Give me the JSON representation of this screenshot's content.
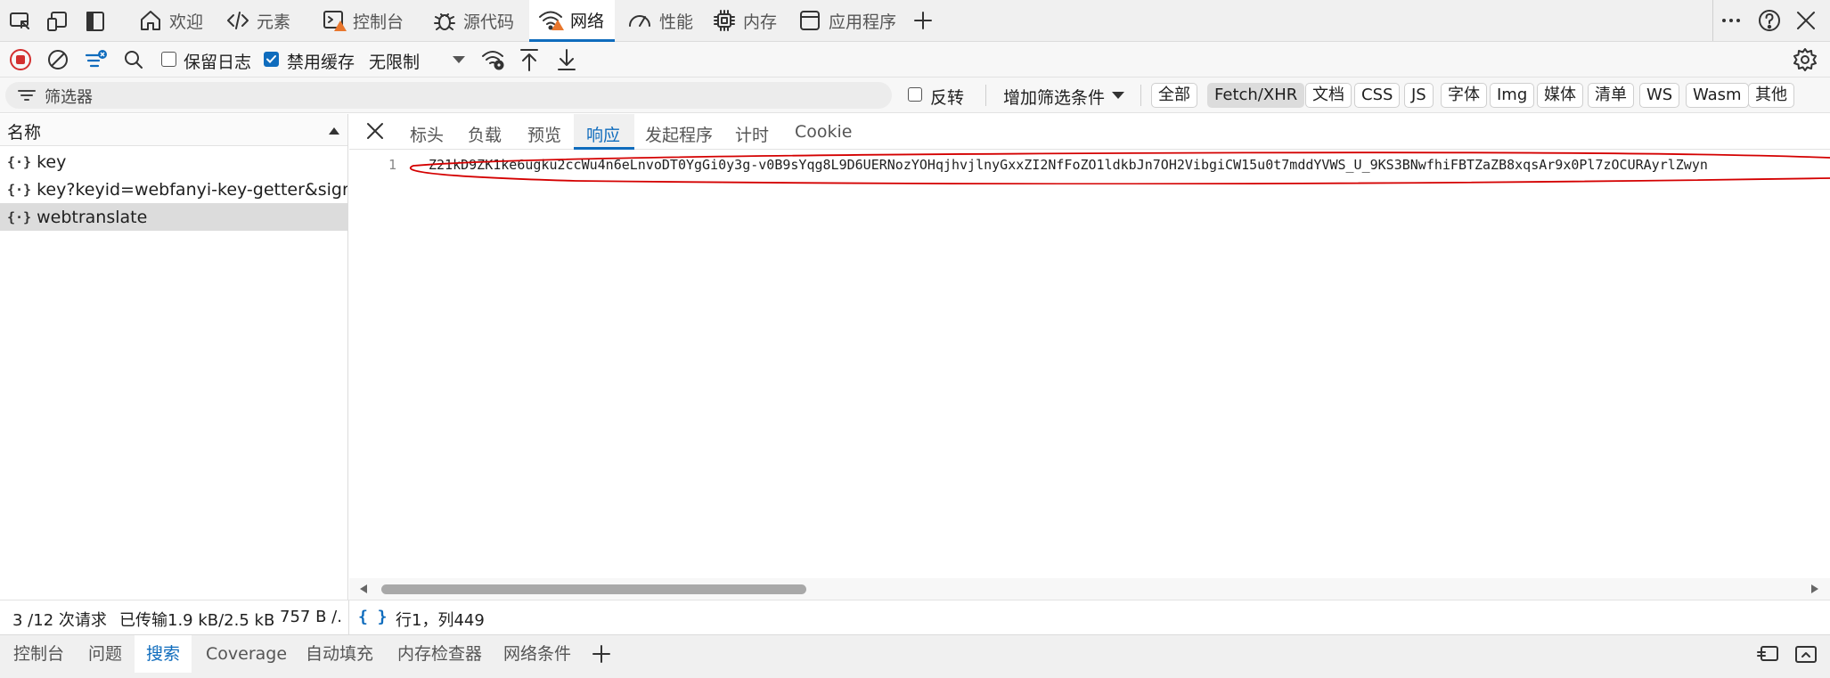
{
  "top_tabs": [
    {
      "label": "欢迎",
      "icon": "home-icon"
    },
    {
      "label": "元素",
      "icon": "code-icon"
    },
    {
      "label": "控制台",
      "icon": "console-icon"
    },
    {
      "label": "源代码",
      "icon": "bug-icon"
    },
    {
      "label": "网络",
      "icon": "wifi-icon"
    },
    {
      "label": "性能",
      "icon": "gauge-icon"
    },
    {
      "label": "内存",
      "icon": "chip-icon"
    },
    {
      "label": "应用程序",
      "icon": "app-icon"
    }
  ],
  "toolbar": {
    "preserve_log_label": "保留日志",
    "preserve_log_checked": false,
    "disable_cache_label": "禁用缓存",
    "disable_cache_checked": true,
    "throttle_value": "无限制"
  },
  "filter": {
    "placeholder": "筛选器",
    "invert_label": "反转",
    "more_filters_label": "增加筛选条件",
    "types": [
      "全部",
      "Fetch/XHR",
      "文档",
      "CSS",
      "JS",
      "字体",
      "Img",
      "媒体",
      "清单",
      "WS",
      "Wasm",
      "其他"
    ],
    "selected_type": "Fetch/XHR"
  },
  "requests": {
    "column_header": "名称",
    "items": [
      {
        "name": "key",
        "selected": false
      },
      {
        "name": "key?keyid=webfanyi-key-getter&sign=...",
        "selected": false
      },
      {
        "name": "webtranslate",
        "selected": true
      }
    ]
  },
  "detail": {
    "tabs": [
      "标头",
      "负载",
      "预览",
      "响应",
      "发起程序",
      "计时",
      "Cookie"
    ],
    "active_tab": "响应",
    "line_number": "1",
    "response_text": "Z21kD9ZK1ke6ugku2ccWu4n6eLnvoDT0YgGi0y3g-v0B9sYqg8L9D6UERNozYOHqjhvjlnyGxxZI2NfFoZO1ldkbJn7OH2VibgiCW15u0t7mddYVWS_U_9KS3BNwfhiFBTZaZB8xqsAr9x0Pl7zOCURAyrlZwyn",
    "scroll_fraction": 0.3
  },
  "status": {
    "requests": "3 /12 次请求",
    "transferred": "已传输1.9 kB/2.5 kB",
    "resources": "757 B /.",
    "cursor": "行1，列449"
  },
  "drawer_tabs": [
    "控制台",
    "问题",
    "搜索",
    "Coverage",
    "自动填充",
    "内存检查器",
    "网络条件"
  ],
  "drawer_active": "搜索",
  "colors": {
    "accent": "#0f6cbd",
    "warning": "#e8762c",
    "record": "#d32f2f",
    "annotation": "#d40000"
  }
}
